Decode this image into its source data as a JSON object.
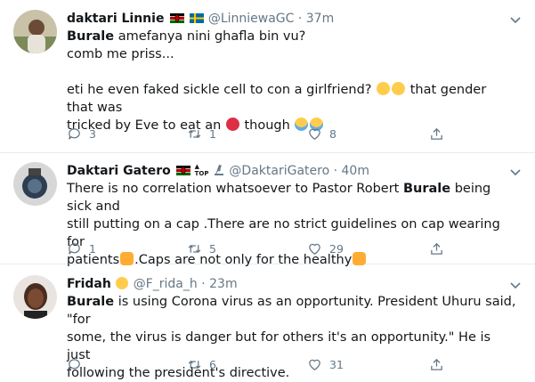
{
  "tweets": [
    {
      "name": "daktari Linnie",
      "handle": "@LinniewaGC",
      "dot": "·",
      "time": "37m",
      "lines": {
        "l1_bold": "Burale",
        "l1_rest": " amefanya nini ghafla bin vu?",
        "l2": "comb me priss...",
        "l4": "eti he even faked sickle cell to con a girlfriend?",
        "l4_after": " that gender that was",
        "l5_a": "tricked by Eve to eat an",
        "l5_b": " though"
      },
      "replies": "3",
      "retweets": "1",
      "likes": "8"
    },
    {
      "name": "Daktari Gatero",
      "badge_text": "TOP",
      "handle": "@DaktariGatero",
      "dot": "·",
      "time": "40m",
      "lines": {
        "l1_a": "There is no correlation whatsoever to Pastor Robert ",
        "l1_bold": "Burale",
        "l1_b": " being sick and",
        "l2": "still putting on a cap .There are no strict guidelines on cap wearing for",
        "l3_a": "patients",
        "l3_b": ".Caps are not only for the healthy"
      },
      "replies": "1",
      "retweets": "5",
      "likes": "29"
    },
    {
      "name": "Fridah",
      "handle": "@F_rida_h",
      "dot": "·",
      "time": "23m",
      "lines": {
        "l1_bold": "Burale",
        "l1_rest": " is using Corona virus as an opportunity. President Uhuru said, \"for",
        "l2": "some, the virus is danger but for others it's an opportunity.\" He is just",
        "l3": "following the president's directive."
      },
      "replies": "",
      "retweets": "6",
      "likes": "31"
    }
  ],
  "colors": {
    "text": "#14171a",
    "muted": "#657786",
    "divider": "#e6ecf0"
  },
  "icons": [
    "reply-icon",
    "retweet-icon",
    "like-icon",
    "share-icon",
    "caret-down-icon"
  ]
}
